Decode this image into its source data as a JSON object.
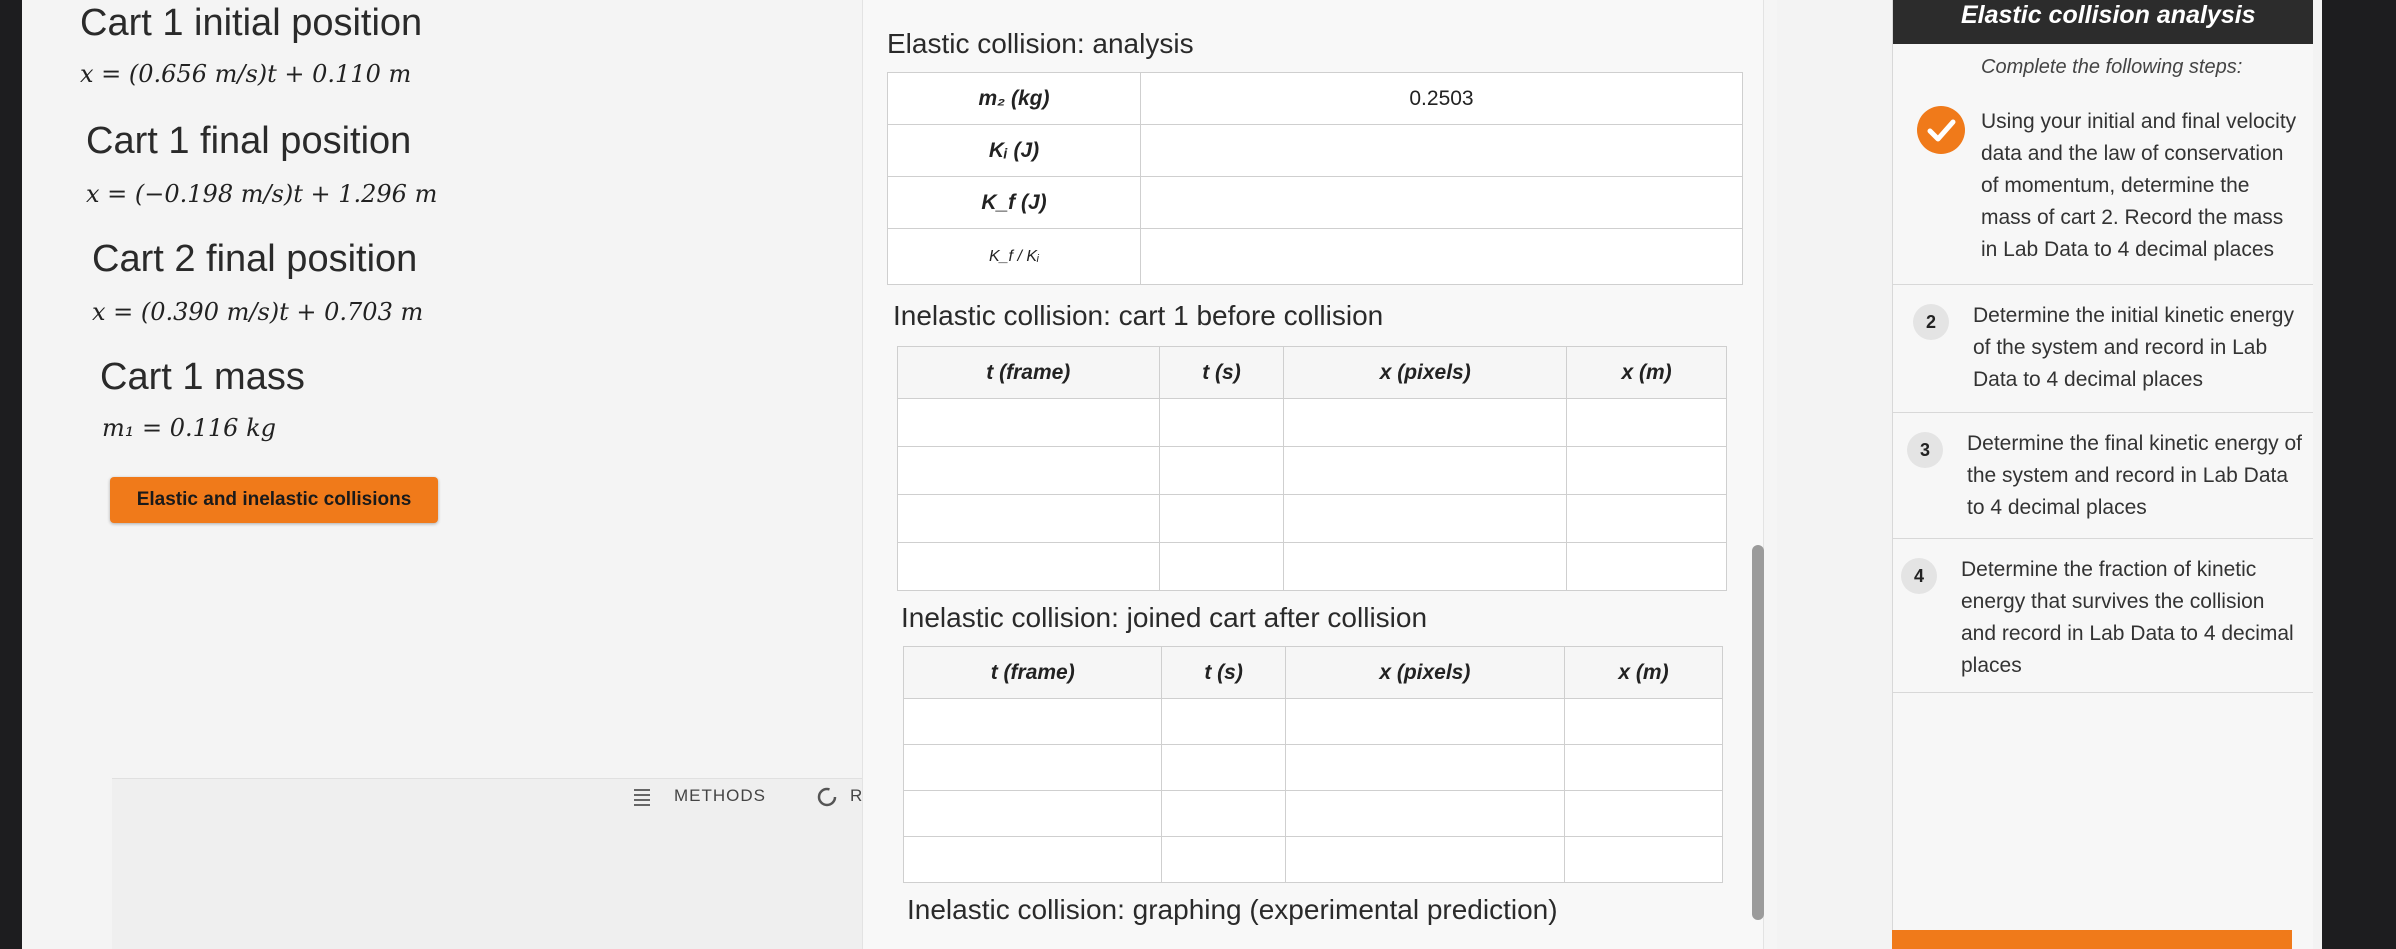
{
  "left": {
    "cart1_initial": {
      "title": "Cart 1 initial position",
      "equation": "x = (0.656 m/s)t + 0.110 m"
    },
    "cart1_final": {
      "title": "Cart 1 final position",
      "equation": "x = (−0.198 m/s)t + 1.296 m"
    },
    "cart2_final": {
      "title": "Cart 2 final position",
      "equation": "x = (0.390 m/s)t + 0.703 m"
    },
    "cart1_mass": {
      "title": "Cart 1 mass",
      "equation": "m₁ = 0.116 kg"
    },
    "button_label": "Elastic and inelastic collisions",
    "methods_label": "METHODS",
    "r_label": "R"
  },
  "middle": {
    "elastic_title": "Elastic collision: analysis",
    "elastic_rows": [
      {
        "label": "m₂ (kg)",
        "value": "0.2503"
      },
      {
        "label": "Kᵢ (J)",
        "value": ""
      },
      {
        "label": "K_f (J)",
        "value": ""
      },
      {
        "label": "K_f / Kᵢ",
        "value": ""
      }
    ],
    "inelastic_before_title": "Inelastic collision: cart 1 before collision",
    "inelastic_after_title": "Inelastic collision: joined cart after collision",
    "columns": [
      "t (frame)",
      "t (s)",
      "x (pixels)",
      "x (m)"
    ],
    "graphing_title": "Inelastic collision: graphing (experimental prediction)"
  },
  "panel": {
    "title": "Elastic collision analysis",
    "subtitle": "Complete the following steps:",
    "steps": [
      {
        "num": "",
        "text": "Using your initial and final velocity data and the law of conservation of momentum, determine the mass of cart 2. Record the mass in Lab Data to 4 decimal places"
      },
      {
        "num": "2",
        "text": "Determine the initial kinetic energy of the system and record in Lab Data to 4 decimal places"
      },
      {
        "num": "3",
        "text": "Determine the final kinetic energy of the system and record in Lab Data to 4 decimal places"
      },
      {
        "num": "4",
        "text": "Determine the fraction of kinetic energy that survives the collision and record in Lab Data to 4 decimal places"
      }
    ]
  }
}
